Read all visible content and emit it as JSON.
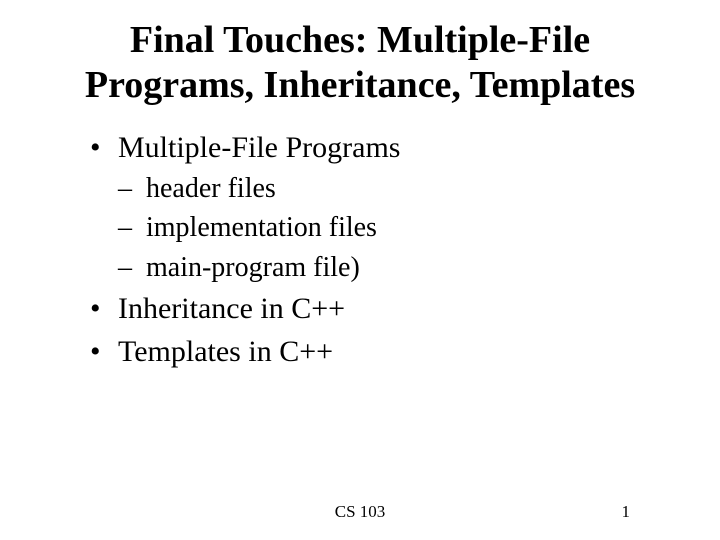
{
  "title": "Final Touches: Multiple-File Programs, Inheritance, Templates",
  "bullets": {
    "item0": "Multiple-File Programs",
    "sub0": "header files",
    "sub1": "implementation files",
    "sub2": "main-program file)",
    "item1": "Inheritance in C++",
    "item2": "Templates in C++"
  },
  "footer": {
    "center": "CS 103",
    "right": "1"
  }
}
